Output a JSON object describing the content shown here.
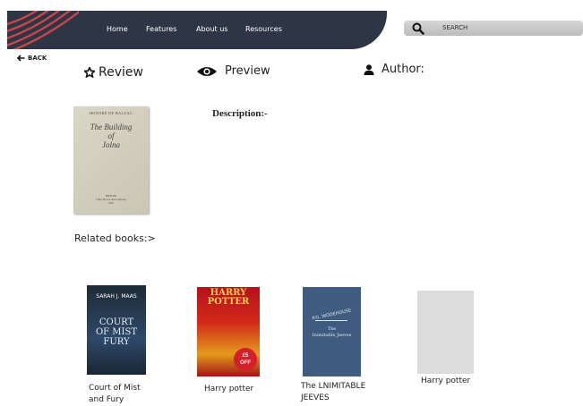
{
  "nav": {
    "items": [
      "Home",
      "Features",
      "About us",
      "Resources"
    ]
  },
  "search": {
    "placeholder": "SEARCH"
  },
  "back": {
    "label": "BACK"
  },
  "tabs": {
    "review": "Review",
    "preview": "Preview",
    "author": "Author:"
  },
  "book": {
    "author": "HONORÉ DE BALZAC",
    "title": "The Building\nof\nJolna",
    "publisher": "BOSTON\nLittle, Brown and Company\n1901"
  },
  "description_label": "Description:-",
  "related_label": "Related books:>",
  "related_books": [
    {
      "title": "Court of Mist\nand Fury",
      "cover_author": "SARAH J. MAAS",
      "cover_title": "COURT\nOF MIST\nFURY"
    },
    {
      "title": "Harry potter",
      "cover_title": "HARRY\nPOTTER",
      "cover_badge": "£5\nOFF"
    },
    {
      "title": "The  LNIMITABLE\nJEEVES",
      "cover_author": "P.G. WODEHOUSE",
      "cover_title": "The\nInimitable Jeeves"
    },
    {
      "title": "Harry potter"
    }
  ],
  "colors": {
    "header_bg": "#2e3545",
    "stripe": "#c8464a"
  }
}
